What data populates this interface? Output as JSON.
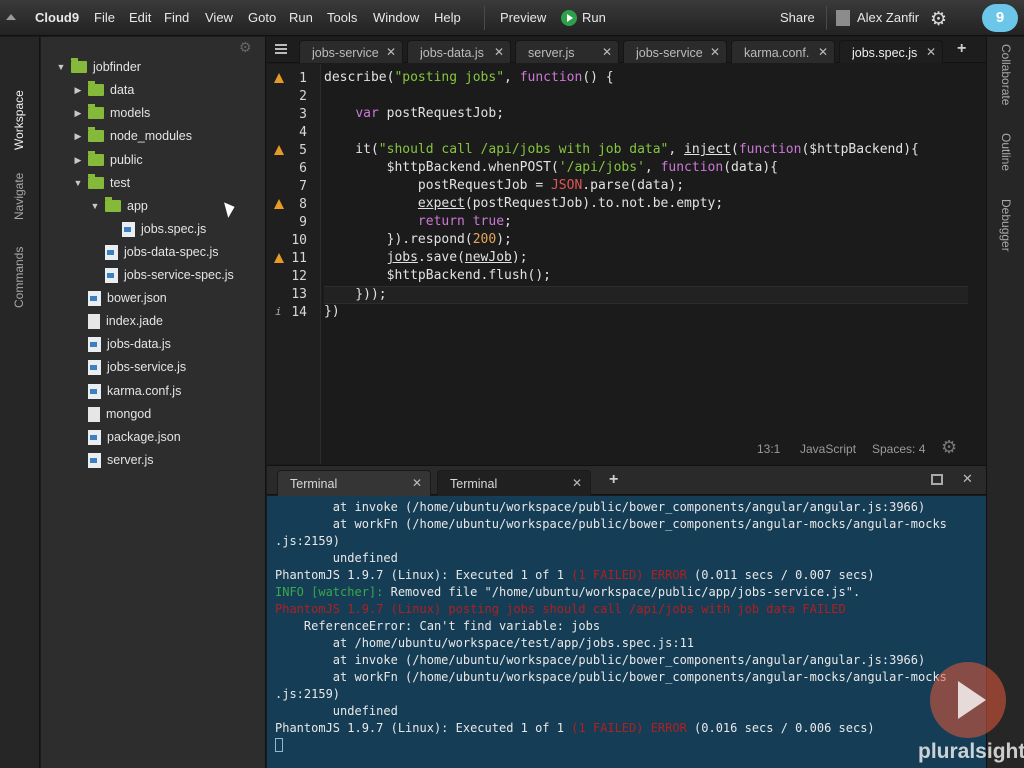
{
  "menubar": {
    "brand": "Cloud9",
    "items": [
      "File",
      "Edit",
      "Find",
      "View",
      "Goto",
      "Run",
      "Tools",
      "Window",
      "Help"
    ],
    "preview": "Preview",
    "run": "Run",
    "share": "Share",
    "user": "Alex Zanfir",
    "logo": "9",
    "icons": [
      "collapse-up-icon",
      "play-icon",
      "user-icon",
      "gear-icon",
      "cloud9-logo-icon"
    ]
  },
  "left_panels": [
    "Workspace",
    "Navigate",
    "Commands"
  ],
  "right_panels": [
    "Collaborate",
    "Outline",
    "Debugger"
  ],
  "tree": [
    {
      "label": "jobfinder",
      "type": "folder",
      "expanded": true,
      "depth": 0
    },
    {
      "label": "data",
      "type": "folder",
      "expanded": false,
      "depth": 1
    },
    {
      "label": "models",
      "type": "folder",
      "expanded": false,
      "depth": 1
    },
    {
      "label": "node_modules",
      "type": "folder",
      "expanded": false,
      "depth": 1
    },
    {
      "label": "public",
      "type": "folder",
      "expanded": false,
      "depth": 1
    },
    {
      "label": "test",
      "type": "folder",
      "expanded": true,
      "depth": 1
    },
    {
      "label": "app",
      "type": "folder",
      "expanded": true,
      "depth": 2
    },
    {
      "label": "jobs.spec.js",
      "type": "js",
      "depth": 3
    },
    {
      "label": "jobs-data-spec.js",
      "type": "js",
      "depth": 2
    },
    {
      "label": "jobs-service-spec.js",
      "type": "js",
      "depth": 2
    },
    {
      "label": "bower.json",
      "type": "js",
      "depth": 1
    },
    {
      "label": "index.jade",
      "type": "plain",
      "depth": 1
    },
    {
      "label": "jobs-data.js",
      "type": "js",
      "depth": 1
    },
    {
      "label": "jobs-service.js",
      "type": "js",
      "depth": 1
    },
    {
      "label": "karma.conf.js",
      "type": "js",
      "depth": 1
    },
    {
      "label": "mongod",
      "type": "plain",
      "depth": 1
    },
    {
      "label": "package.json",
      "type": "js",
      "depth": 1
    },
    {
      "label": "server.js",
      "type": "js",
      "depth": 1
    }
  ],
  "editor_tabs": [
    {
      "label": "jobs-service",
      "active": false
    },
    {
      "label": "jobs-data.js",
      "active": false
    },
    {
      "label": "server.js",
      "active": false
    },
    {
      "label": "jobs-service",
      "active": false
    },
    {
      "label": "karma.conf.",
      "active": false
    },
    {
      "label": "jobs.spec.js",
      "active": true
    }
  ],
  "code": [
    {
      "n": "1",
      "marker": "warning",
      "code": "describe(\"posting jobs\", function() {"
    },
    {
      "n": "2",
      "marker": "",
      "code": ""
    },
    {
      "n": "3",
      "marker": "",
      "code": "    var postRequestJob;"
    },
    {
      "n": "4",
      "marker": "",
      "code": ""
    },
    {
      "n": "5",
      "marker": "warning",
      "code": "    it(\"should call /api/jobs with job data\", inject(function($httpBackend){"
    },
    {
      "n": "6",
      "marker": "",
      "code": "        $httpBackend.whenPOST('/api/jobs', function(data){"
    },
    {
      "n": "7",
      "marker": "",
      "code": "            postRequestJob = JSON.parse(data);"
    },
    {
      "n": "8",
      "marker": "warning",
      "code": "            expect(postRequestJob).to.not.be.empty;"
    },
    {
      "n": "9",
      "marker": "",
      "code": "            return true;"
    },
    {
      "n": "10",
      "marker": "",
      "code": "        }).respond(200);"
    },
    {
      "n": "11",
      "marker": "warning",
      "code": "        jobs.save(newJob);"
    },
    {
      "n": "12",
      "marker": "",
      "code": "        $httpBackend.flush();"
    },
    {
      "n": "13",
      "marker": "",
      "code": "    }));"
    },
    {
      "n": "14",
      "marker": "info",
      "code": "})"
    }
  ],
  "status": {
    "position": "13:1",
    "language": "JavaScript",
    "spaces": "Spaces: 4"
  },
  "terminal_tabs": [
    {
      "label": "Terminal",
      "active": false
    },
    {
      "label": "Terminal",
      "active": true
    }
  ],
  "terminal_lines": [
    {
      "text": "        at invoke (/home/ubuntu/workspace/public/bower_components/angular/angular.js:3966)",
      "style": "normal"
    },
    {
      "text": "        at workFn (/home/ubuntu/workspace/public/bower_components/angular-mocks/angular-mocks",
      "style": "normal"
    },
    {
      "text": ".js:2159)",
      "style": "normal"
    },
    {
      "text": "        undefined",
      "style": "normal"
    },
    {
      "text": "PhantomJS 1.9.7 (Linux): Executed 1 of 1 ",
      "red": "(1 FAILED) ERROR",
      "rest": " (0.011 secs / 0.007 secs)",
      "style": "mixed"
    },
    {
      "text": "INFO [watcher]:",
      "rest": " Removed file \"/home/ubuntu/workspace/public/app/jobs-service.js\".",
      "style": "info"
    },
    {
      "text": "PhantomJS 1.9.7 (Linux) posting jobs should call /api/jobs with job data FAILED",
      "style": "red"
    },
    {
      "text": "    ReferenceError: Can't find variable: jobs",
      "style": "normal"
    },
    {
      "text": "        at /home/ubuntu/workspace/test/app/jobs.spec.js:11",
      "style": "normal"
    },
    {
      "text": "        at invoke (/home/ubuntu/workspace/public/bower_components/angular/angular.js:3966)",
      "style": "normal"
    },
    {
      "text": "        at workFn (/home/ubuntu/workspace/public/bower_components/angular-mocks/angular-mocks",
      "style": "normal"
    },
    {
      "text": ".js:2159)",
      "style": "normal"
    },
    {
      "text": "        undefined",
      "style": "normal"
    },
    {
      "text": "PhantomJS 1.9.7 (Linux): Executed 1 of 1 ",
      "red": "(1 FAILED) ERROR",
      "rest": " (0.016 secs / 0.006 secs)",
      "style": "mixed"
    }
  ],
  "watermark": {
    "brand": "pluralsight"
  },
  "colors": {
    "accent": "#84b93a",
    "terminal_bg": "#153d55",
    "error": "#b02020",
    "info": "#3aa84b",
    "warning": "#e69a28"
  }
}
